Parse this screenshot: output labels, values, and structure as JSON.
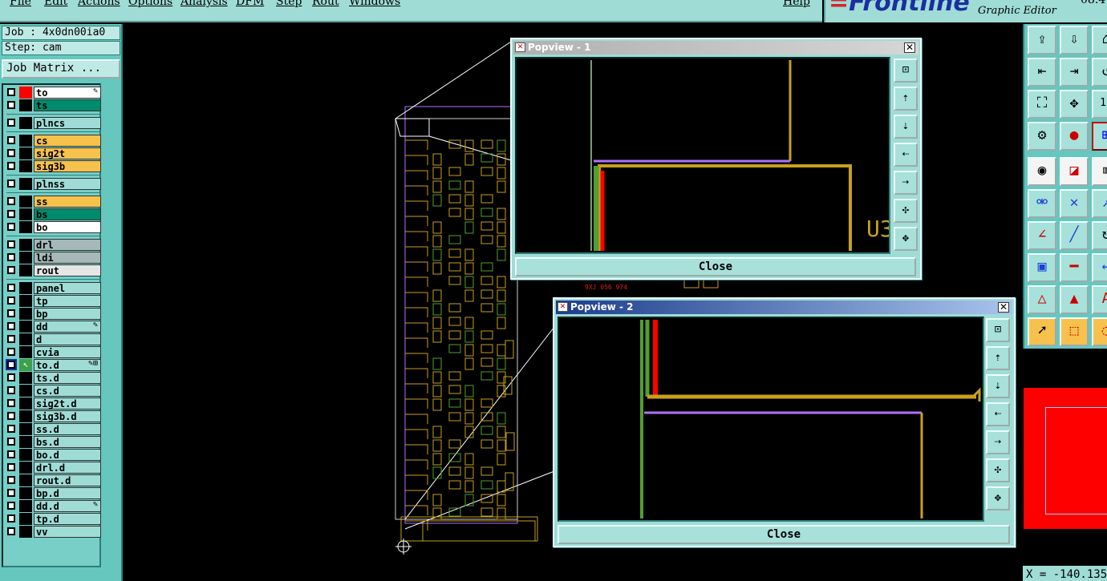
{
  "menu": {
    "items": [
      "File",
      "Edit",
      "Actions",
      "Options",
      "Analysis",
      "DFM",
      "Step",
      "Rout",
      "Windows",
      "Help"
    ]
  },
  "brand": {
    "logo": "Frontline",
    "subtitle": "Graphic Editor",
    "version": "08.4"
  },
  "job": {
    "job_line": "Job : 4x0dn00ia0",
    "step_line": "Step: cam",
    "matrix_button": "Job Matrix ..."
  },
  "layers": [
    {
      "name": "to",
      "color": "#ffffff",
      "marker": "#ff0000",
      "icon": "edit"
    },
    {
      "name": "ts",
      "color": "#008b6d",
      "marker": "#000000"
    },
    {
      "name": "plncs",
      "color": "#9fdcd6",
      "marker": "#000000"
    },
    {
      "name": "cs",
      "color": "#f6c14c",
      "marker": "#000000"
    },
    {
      "name": "sig2t",
      "color": "#f6c14c",
      "marker": "#000000"
    },
    {
      "name": "sig3b",
      "color": "#f6c14c",
      "marker": "#000000"
    },
    {
      "name": "plnss",
      "color": "#9fdcd6",
      "marker": "#000000"
    },
    {
      "name": "ss",
      "color": "#f6c14c",
      "marker": "#000000"
    },
    {
      "name": "bs",
      "color": "#008b6d",
      "marker": "#000000"
    },
    {
      "name": "bo",
      "color": "#ffffff",
      "marker": "#000000"
    },
    {
      "name": "drl",
      "color": "#a6b8b8",
      "marker": "#000000"
    },
    {
      "name": "ldi",
      "color": "#a6b8b8",
      "marker": "#000000"
    },
    {
      "name": "rout",
      "color": "#e6e6e6",
      "marker": "#000000"
    },
    {
      "name": "panel",
      "color": "#9fdcd6",
      "marker": "#000000"
    },
    {
      "name": "tp",
      "color": "#9fdcd6",
      "marker": "#000000"
    },
    {
      "name": "bp",
      "color": "#9fdcd6",
      "marker": "#000000"
    },
    {
      "name": "dd",
      "color": "#9fdcd6",
      "marker": "#000000",
      "icon": "edit"
    },
    {
      "name": "d",
      "color": "#9fdcd6",
      "marker": "#000000"
    },
    {
      "name": "cvia",
      "color": "#9fdcd6",
      "marker": "#000000"
    },
    {
      "name": "to.d",
      "color": "#9fdcd6",
      "marker": "#3aa04a",
      "icon": "edit-grid",
      "active": true
    },
    {
      "name": "ts.d",
      "color": "#9fdcd6",
      "marker": "#000000"
    },
    {
      "name": "cs.d",
      "color": "#9fdcd6",
      "marker": "#000000"
    },
    {
      "name": "sig2t.d",
      "color": "#9fdcd6",
      "marker": "#000000"
    },
    {
      "name": "sig3b.d",
      "color": "#9fdcd6",
      "marker": "#000000"
    },
    {
      "name": "ss.d",
      "color": "#9fdcd6",
      "marker": "#000000"
    },
    {
      "name": "bs.d",
      "color": "#9fdcd6",
      "marker": "#000000"
    },
    {
      "name": "bo.d",
      "color": "#9fdcd6",
      "marker": "#000000"
    },
    {
      "name": "drl.d",
      "color": "#9fdcd6",
      "marker": "#000000"
    },
    {
      "name": "rout.d",
      "color": "#9fdcd6",
      "marker": "#000000"
    },
    {
      "name": "bp.d",
      "color": "#9fdcd6",
      "marker": "#000000"
    },
    {
      "name": "dd.d",
      "color": "#9fdcd6",
      "marker": "#000000",
      "icon": "edit"
    },
    {
      "name": "tp.d",
      "color": "#9fdcd6",
      "marker": "#000000"
    },
    {
      "name": "vv",
      "color": "#9fdcd6",
      "marker": "#000000"
    }
  ],
  "canvas": {
    "silk_text_1": "9XJ 056 974",
    "refdes": "U3"
  },
  "popview1": {
    "title": "Popview - 1",
    "close_label": "Close",
    "titlebar_color": "#b8b8b8"
  },
  "popview2": {
    "title": "Popview - 2",
    "close_label": "Close",
    "titlebar_color": "#1c3d8c"
  },
  "coords": {
    "x": "X = -140.135"
  },
  "colors": {
    "gold": "#c8a01c",
    "purple": "#b070ff",
    "green": "#4fa030",
    "red": "#ff0000",
    "teal": "#66c7bf"
  }
}
